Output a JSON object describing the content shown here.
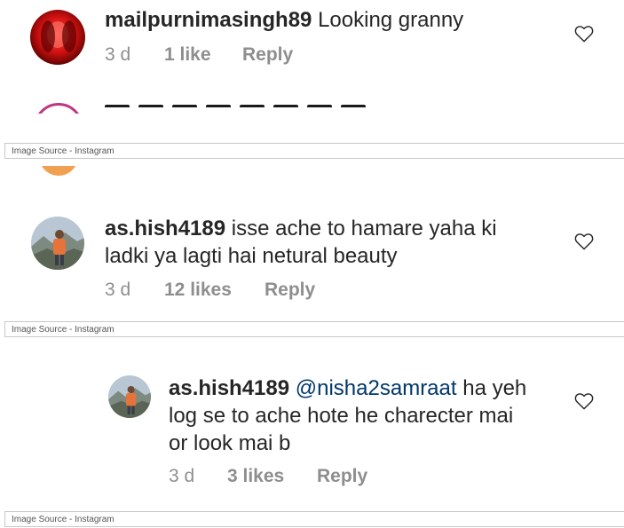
{
  "comments": [
    {
      "username": "mailpurnimasingh89",
      "text": "Looking granny",
      "time": "3 d",
      "likes": "1 like",
      "reply": "Reply"
    },
    {
      "username": "as.hish4189",
      "text_line1": "isse ache to hamare yaha ki",
      "text_line2": "ladki ya lagti hai netural beauty",
      "time": "3 d",
      "likes": "12 likes",
      "reply": "Reply"
    },
    {
      "username": "as.hish4189",
      "mention": "@nisha2samraat",
      "text_line1": "ha yeh",
      "text_line2": "log se to ache hote he charecter mai",
      "text_line3": "or look mai b",
      "time": "3 d",
      "likes": "3 likes",
      "reply": "Reply"
    }
  ],
  "source_label": "Image Source - Instagram",
  "icons": [
    "heart-outline-icon",
    "avatar-red",
    "avatar-mountain"
  ],
  "colors": {
    "text": "#262626",
    "meta": "#8e8e8e",
    "mention": "#00376b"
  }
}
